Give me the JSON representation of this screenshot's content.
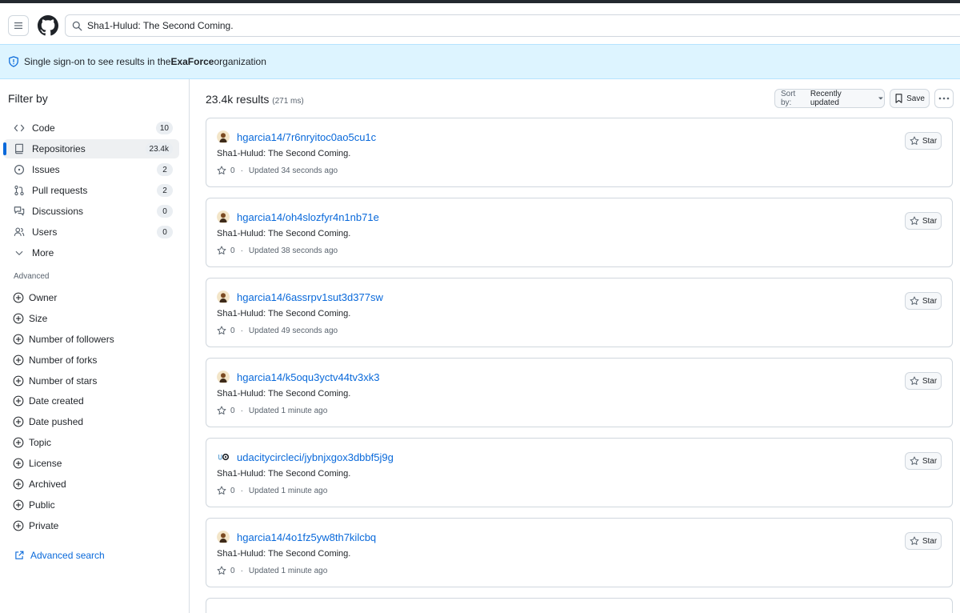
{
  "header": {
    "search_value": "Sha1-Hulud: The Second Coming."
  },
  "banner": {
    "prefix": "Single sign-on to see results in the ",
    "org": "ExaForce",
    "suffix": " organization"
  },
  "sidebar": {
    "title": "Filter by",
    "items": [
      {
        "label": "Code",
        "count": "10",
        "icon": "code-icon"
      },
      {
        "label": "Repositories",
        "count": "23.4k",
        "icon": "repo-icon",
        "active": true
      },
      {
        "label": "Issues",
        "count": "2",
        "icon": "issue-icon"
      },
      {
        "label": "Pull requests",
        "count": "2",
        "icon": "pull-request-icon"
      },
      {
        "label": "Discussions",
        "count": "0",
        "icon": "discussion-icon"
      },
      {
        "label": "Users",
        "count": "0",
        "icon": "users-icon"
      },
      {
        "label": "More",
        "icon": "chevron-down-icon"
      }
    ],
    "advanced_heading": "Advanced",
    "advanced_items": [
      "Owner",
      "Size",
      "Number of followers",
      "Number of forks",
      "Number of stars",
      "Date created",
      "Date pushed",
      "Topic",
      "License",
      "Archived",
      "Public",
      "Private"
    ],
    "advanced_search": "Advanced search"
  },
  "results": {
    "count_text": "23.4k results",
    "time_text": "(271 ms)",
    "sort_label": "Sort by:",
    "sort_value": "Recently updated",
    "save_label": "Save",
    "star_label": "Star",
    "items": [
      {
        "repo": "hgarcia14/7r6nryitoc0ao5cu1c",
        "description": "Sha1-Hulud: The Second Coming.",
        "stars": "0",
        "updated": "Updated 34 seconds ago",
        "avatar": "person"
      },
      {
        "repo": "hgarcia14/oh4slozfyr4n1nb71e",
        "description": "Sha1-Hulud: The Second Coming.",
        "stars": "0",
        "updated": "Updated 38 seconds ago",
        "avatar": "person"
      },
      {
        "repo": "hgarcia14/6assrpv1sut3d377sw",
        "description": "Sha1-Hulud: The Second Coming.",
        "stars": "0",
        "updated": "Updated 49 seconds ago",
        "avatar": "person"
      },
      {
        "repo": "hgarcia14/k5oqu3yctv44tv3xk3",
        "description": "Sha1-Hulud: The Second Coming.",
        "stars": "0",
        "updated": "Updated 1 minute ago",
        "avatar": "person"
      },
      {
        "repo": "udacitycircleci/jybnjxgox3dbbf5j9g",
        "description": "Sha1-Hulud: The Second Coming.",
        "stars": "0",
        "updated": "Updated 1 minute ago",
        "avatar": "logo"
      },
      {
        "repo": "hgarcia14/4o1fz5yw8th7kilcbq",
        "description": "Sha1-Hulud: The Second Coming.",
        "stars": "0",
        "updated": "Updated 1 minute ago",
        "avatar": "person"
      }
    ]
  },
  "colors": {
    "accent": "#0969da",
    "banner_bg": "#ddf4ff",
    "border": "#d0d7de",
    "muted": "#59636e"
  }
}
